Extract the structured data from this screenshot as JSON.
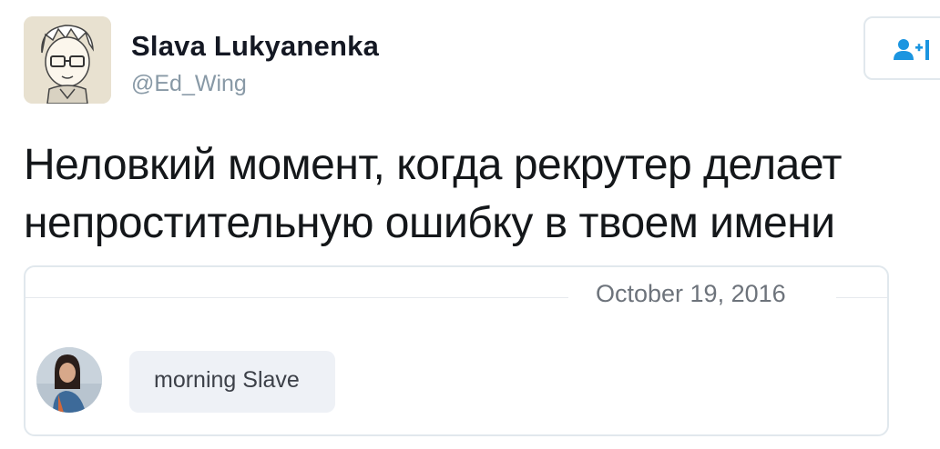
{
  "tweet": {
    "author": {
      "display_name": "Slava Lukyanenka",
      "handle": "@Ed_Wing",
      "avatar_icon": "cartoon-avatar-glasses"
    },
    "follow_button": {
      "icon": "add-user-icon",
      "color": "#1b95e0"
    },
    "text_lines": [
      "Неловкий момент, когда рекрутер делает",
      "непростительную ошибку в твоем имени"
    ],
    "attached_chat": {
      "date": "October 19, 2016",
      "message": {
        "text": "morning Slave",
        "sender_avatar_icon": "user-photo-avatar"
      }
    }
  }
}
